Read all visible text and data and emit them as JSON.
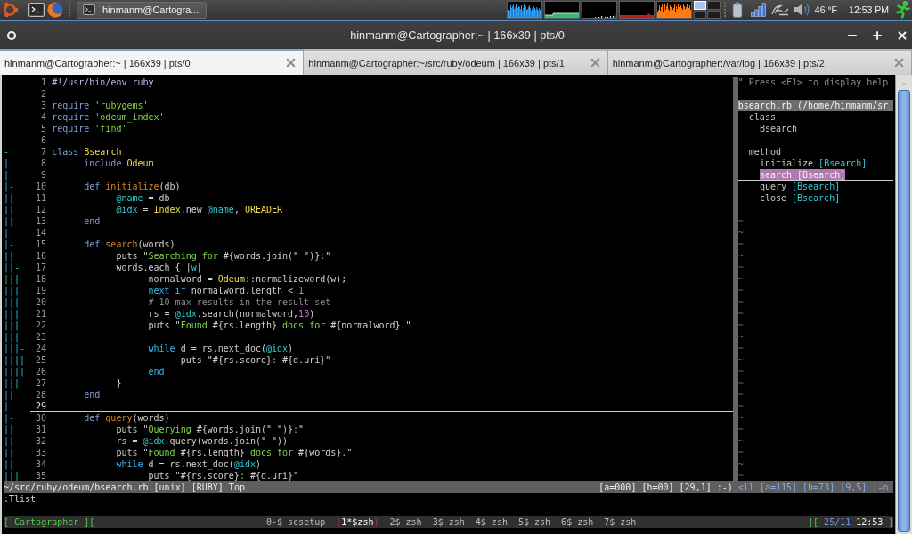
{
  "panel": {
    "taskbar_button": "hinmanm@Cartogra...",
    "workspaces": [
      {
        "selected": true
      },
      {
        "selected": false
      },
      {
        "selected": false
      },
      {
        "selected": false
      }
    ],
    "temperature": "46 °F",
    "clock": "12:53 PM"
  },
  "window": {
    "title": "hinmanm@Cartographer:~ | 166x39 | pts/0"
  },
  "tabs": [
    {
      "label": "hinmanm@Cartographer:~ | 166x39 | pts/0",
      "selected": true
    },
    {
      "label": "hinmanm@Cartographer:~/src/ruby/odeum | 166x39 | pts/1",
      "selected": false
    },
    {
      "label": "hinmanm@Cartographer:/var/log | 166x39 | pts/2",
      "selected": false
    }
  ],
  "editor": {
    "lines": [
      {
        "number": "1",
        "current": false,
        "code": [
          {
            "kind": "shebang",
            "text": "#!/usr/bin/env ruby"
          }
        ]
      },
      {
        "number": "2",
        "current": false
      },
      {
        "number": "3",
        "current": false,
        "code": [
          {
            "kind": "keyword",
            "text": "require"
          },
          {
            "kind": "string",
            "text": " 'rubygems'"
          }
        ]
      },
      {
        "number": "4",
        "current": false,
        "code": [
          {
            "kind": "keyword",
            "text": "require"
          },
          {
            "kind": "string",
            "text": " 'odeum_index'"
          }
        ]
      },
      {
        "number": "5",
        "current": false,
        "code": [
          {
            "kind": "keyword",
            "text": "require"
          },
          {
            "kind": "string",
            "text": " 'find'"
          }
        ]
      },
      {
        "number": "6",
        "current": false
      },
      {
        "fold": "-",
        "number": "7",
        "current": false,
        "code": [
          {
            "kind": "keyword",
            "text": "class"
          },
          {
            "kind": "constant",
            "text": " Bsearch"
          }
        ]
      },
      {
        "fold": "|",
        "number": "8",
        "current": false,
        "code": [
          {
            "kind": "keyword",
            "text": "      include"
          },
          {
            "kind": "constant",
            "text": " Odeum"
          }
        ]
      },
      {
        "fold": "|",
        "number": "9",
        "current": false
      },
      {
        "fold": "|-",
        "number": "10",
        "current": false,
        "code": [
          {
            "kind": "keyword",
            "text": "      def"
          },
          {
            "kind": "method",
            "text": " initialize"
          },
          {
            "kind": "plain",
            "text": "(db)"
          }
        ]
      },
      {
        "fold": "||",
        "number": "11",
        "current": false,
        "code": [
          {
            "kind": "ivar",
            "text": "            @name"
          },
          {
            "kind": "plain",
            "text": " = db"
          }
        ]
      },
      {
        "fold": "||",
        "number": "12",
        "current": false,
        "code": [
          {
            "kind": "ivar",
            "text": "            @idx"
          },
          {
            "kind": "plain",
            "text": " = "
          },
          {
            "kind": "constant",
            "text": "Index"
          },
          {
            "kind": "plain",
            "text": ".new "
          },
          {
            "kind": "ivar",
            "text": "@name"
          },
          {
            "kind": "plain",
            "text": ", "
          },
          {
            "kind": "constant",
            "text": "OREADER"
          }
        ]
      },
      {
        "fold": "||",
        "number": "13",
        "current": false,
        "code": [
          {
            "kind": "keyword",
            "text": "      end"
          }
        ]
      },
      {
        "fold": "|",
        "number": "14",
        "current": false
      },
      {
        "fold": "|-",
        "number": "15",
        "current": false,
        "code": [
          {
            "kind": "keyword",
            "text": "      def"
          },
          {
            "kind": "method",
            "text": " search"
          },
          {
            "kind": "plain",
            "text": "(words)"
          }
        ]
      },
      {
        "fold": "||",
        "number": "16",
        "current": false,
        "code": [
          {
            "kind": "plain",
            "text": "            puts \""
          },
          {
            "kind": "string",
            "text": "Searching for "
          },
          {
            "kind": "plain",
            "text": "#{words.join(\" \")}"
          },
          {
            "kind": "string",
            "text": ":"
          },
          {
            "kind": "plain",
            "text": "\""
          }
        ]
      },
      {
        "fold": "||-",
        "number": "17",
        "current": false,
        "code": [
          {
            "kind": "plain",
            "text": "            words.each { |"
          },
          {
            "kind": "ivar",
            "text": "w"
          },
          {
            "kind": "plain",
            "text": "|"
          }
        ]
      },
      {
        "fold": "|||",
        "number": "18",
        "current": false,
        "code": [
          {
            "kind": "plain",
            "text": "                  normalword = "
          },
          {
            "kind": "constant",
            "text": "Odeum"
          },
          {
            "kind": "plain",
            "text": "::normalizeword(w);"
          }
        ]
      },
      {
        "fold": "|||",
        "number": "19",
        "current": false,
        "code": [
          {
            "kind": "control",
            "text": "                  next if"
          },
          {
            "kind": "plain",
            "text": " normalword.length < "
          },
          {
            "kind": "number",
            "text": "1"
          }
        ]
      },
      {
        "fold": "|||",
        "number": "20",
        "current": false,
        "code": [
          {
            "kind": "comment",
            "text": "                  # 10 max results in the result-set"
          }
        ]
      },
      {
        "fold": "|||",
        "number": "21",
        "current": false,
        "code": [
          {
            "kind": "plain",
            "text": "                  rs = "
          },
          {
            "kind": "ivar",
            "text": "@idx"
          },
          {
            "kind": "plain",
            "text": ".search(normalword,"
          },
          {
            "kind": "number",
            "text": "10"
          },
          {
            "kind": "plain",
            "text": ")"
          }
        ]
      },
      {
        "fold": "|||",
        "number": "22",
        "current": false,
        "code": [
          {
            "kind": "plain",
            "text": "                  puts \""
          },
          {
            "kind": "string",
            "text": "Found "
          },
          {
            "kind": "plain",
            "text": "#{rs.length}"
          },
          {
            "kind": "string",
            "text": " docs for "
          },
          {
            "kind": "plain",
            "text": "#{normalword}"
          },
          {
            "kind": "string",
            "text": "."
          },
          {
            "kind": "plain",
            "text": "\""
          }
        ]
      },
      {
        "fold": "|||",
        "number": "23",
        "current": false
      },
      {
        "fold": "|||-",
        "number": "24",
        "current": false,
        "code": [
          {
            "kind": "control",
            "text": "                  while"
          },
          {
            "kind": "plain",
            "text": " d = rs.next_doc("
          },
          {
            "kind": "ivar",
            "text": "@idx"
          },
          {
            "kind": "plain",
            "text": ")"
          }
        ]
      },
      {
        "fold": "||||",
        "number": "25",
        "current": false,
        "code": [
          {
            "kind": "plain",
            "text": "                        puts \"#{rs.score}"
          },
          {
            "kind": "string",
            "text": ": "
          },
          {
            "kind": "plain",
            "text": "#{d.uri}\""
          }
        ]
      },
      {
        "fold": "||||",
        "number": "26",
        "current": false,
        "code": [
          {
            "kind": "control",
            "text": "                  end"
          }
        ]
      },
      {
        "fold": "|||",
        "number": "27",
        "current": false,
        "code": [
          {
            "kind": "plain",
            "text": "            }"
          }
        ]
      },
      {
        "fold": "||",
        "number": "28",
        "current": false,
        "code": [
          {
            "kind": "keyword",
            "text": "      end"
          }
        ]
      },
      {
        "fold": "|",
        "number": "29",
        "current": true
      },
      {
        "fold": "|-",
        "number": "30",
        "current": false,
        "code": [
          {
            "kind": "keyword",
            "text": "      def"
          },
          {
            "kind": "method",
            "text": " query"
          },
          {
            "kind": "plain",
            "text": "(words)"
          }
        ]
      },
      {
        "fold": "||",
        "number": "31",
        "current": false,
        "code": [
          {
            "kind": "plain",
            "text": "            puts \""
          },
          {
            "kind": "string",
            "text": "Querying "
          },
          {
            "kind": "plain",
            "text": "#{words.join(\" \")}"
          },
          {
            "kind": "string",
            "text": ":"
          },
          {
            "kind": "plain",
            "text": "\""
          }
        ]
      },
      {
        "fold": "||",
        "number": "32",
        "current": false,
        "code": [
          {
            "kind": "plain",
            "text": "            rs = "
          },
          {
            "kind": "ivar",
            "text": "@idx"
          },
          {
            "kind": "plain",
            "text": ".query(words.join(\" \"))"
          }
        ]
      },
      {
        "fold": "||",
        "number": "33",
        "current": false,
        "code": [
          {
            "kind": "plain",
            "text": "            puts \""
          },
          {
            "kind": "string",
            "text": "Found "
          },
          {
            "kind": "plain",
            "text": "#{rs.length}"
          },
          {
            "kind": "string",
            "text": " docs for "
          },
          {
            "kind": "plain",
            "text": "#{words}"
          },
          {
            "kind": "string",
            "text": "."
          },
          {
            "kind": "plain",
            "text": "\""
          }
        ]
      },
      {
        "fold": "||-",
        "number": "34",
        "current": false,
        "code": [
          {
            "kind": "control",
            "text": "            while"
          },
          {
            "kind": "plain",
            "text": " d = rs.next_doc("
          },
          {
            "kind": "ivar",
            "text": "@idx"
          },
          {
            "kind": "plain",
            "text": ")"
          }
        ]
      },
      {
        "fold": "|||",
        "number": "35",
        "current": false,
        "code": [
          {
            "kind": "plain",
            "text": "                  puts \"#{rs.score}"
          },
          {
            "kind": "string",
            "text": ": "
          },
          {
            "kind": "plain",
            "text": "#{d.uri}\""
          }
        ]
      }
    ],
    "status": {
      "file": "~/src/ruby/odeum/bsearch.rb [unix] [RUBY] Top",
      "position": "[a=000] [h=00] [29,1] :-)"
    }
  },
  "taglist": {
    "help": "\" Press <F1> to display help",
    "file": "bsearch.rb (/home/hinmanm/sr",
    "groups": [
      {
        "label": "class",
        "children": [
          {
            "name": "Bsearch",
            "selected": false
          }
        ]
      },
      {
        "label": "method",
        "children": [
          {
            "name": "initialize",
            "scope": "[Bsearch]",
            "selected": false
          },
          {
            "name": "search",
            "scope": "[Bsearch]",
            "selected": true
          },
          {
            "name": "query",
            "scope": "[Bsearch]",
            "selected": false
          },
          {
            "name": "close",
            "scope": "[Bsearch]",
            "selected": false
          }
        ]
      }
    ],
    "filler": [
      "~",
      "~",
      "~",
      "~",
      "~",
      "~",
      "~",
      "~",
      "~",
      "~",
      "~",
      "~",
      "~",
      "~",
      "~",
      "~",
      "~",
      "~",
      "~",
      "~",
      "~",
      "~",
      "~"
    ],
    "status": "<ll [a=115] [h=73] [9,5] |-o"
  },
  "command_line": ":Tlist",
  "screen_bar": {
    "session": "[ Cartographer ][",
    "windows": [
      {
        "label": "0-$ scsetup",
        "selected": false
      },
      {
        "label": "1*$zsh",
        "selected": true,
        "open": "(",
        "close": ")"
      },
      {
        "label": "2$ zsh",
        "selected": false
      },
      {
        "label": "3$ zsh",
        "selected": false
      },
      {
        "label": "4$ zsh",
        "selected": false
      },
      {
        "label": "5$ zsh",
        "selected": false
      },
      {
        "label": "6$ zsh",
        "selected": false
      },
      {
        "label": "7$ zsh",
        "selected": false
      }
    ],
    "clock": [
      {
        "kind": "bracket",
        "text": "]["
      },
      {
        "kind": "date",
        "text": "25/11"
      },
      {
        "kind": "time",
        "text": "12:53"
      },
      {
        "kind": "bracket",
        "text": "]"
      }
    ]
  }
}
